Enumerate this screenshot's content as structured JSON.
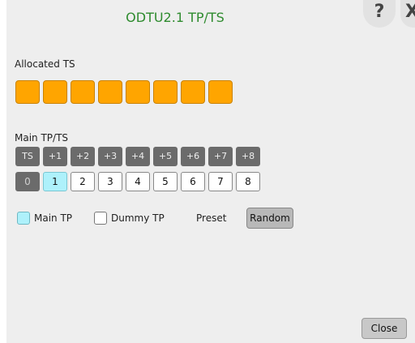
{
  "dialog": {
    "title": "ODTU2.1 TP/TS",
    "help_label": "?",
    "close_icon_label": "X"
  },
  "allocated": {
    "label": "Allocated TS",
    "count": 8,
    "block_color": "#ffa500"
  },
  "main_tp_ts": {
    "label": "Main TP/TS",
    "headers": [
      "TS",
      "+1",
      "+2",
      "+3",
      "+4",
      "+5",
      "+6",
      "+7",
      "+8"
    ],
    "values": [
      "0",
      "1",
      "2",
      "3",
      "4",
      "5",
      "6",
      "7",
      "8"
    ],
    "disabled_index": 0,
    "selected_index": 1
  },
  "legend": {
    "main_tp": "Main TP",
    "dummy_tp": "Dummy TP",
    "main_tp_color": "#aef1fb"
  },
  "preset": {
    "label": "Preset",
    "button": "Random"
  },
  "footer": {
    "close_label": "Close"
  }
}
